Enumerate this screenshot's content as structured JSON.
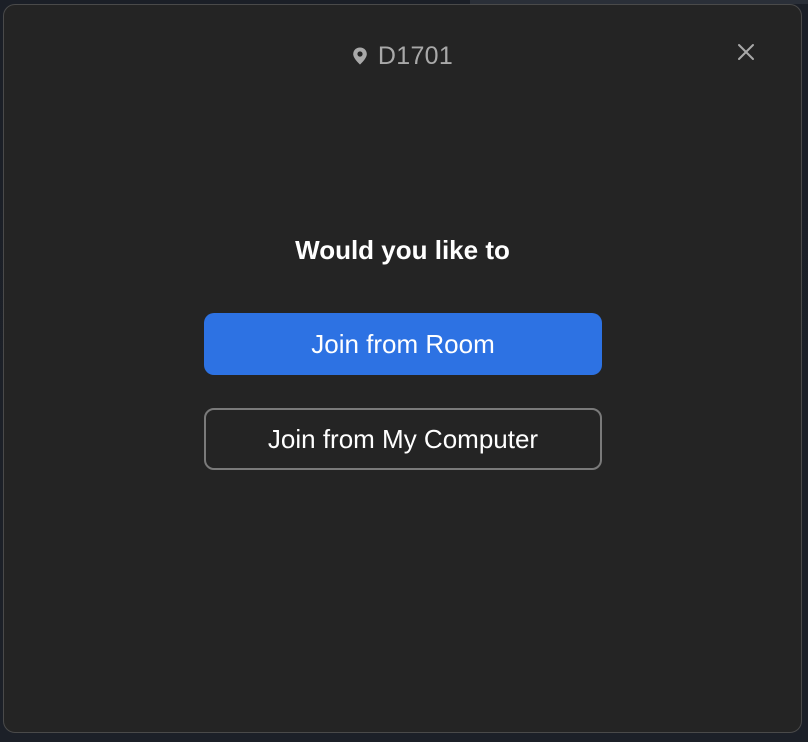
{
  "dialog": {
    "location": {
      "icon": "location-pin-icon",
      "label": "D1701"
    },
    "close_icon": "close-icon",
    "question": "Would you like to",
    "primary_button": {
      "label": "Join from Room",
      "color": "#2d72e3"
    },
    "secondary_button": {
      "label": "Join from My Computer"
    }
  }
}
